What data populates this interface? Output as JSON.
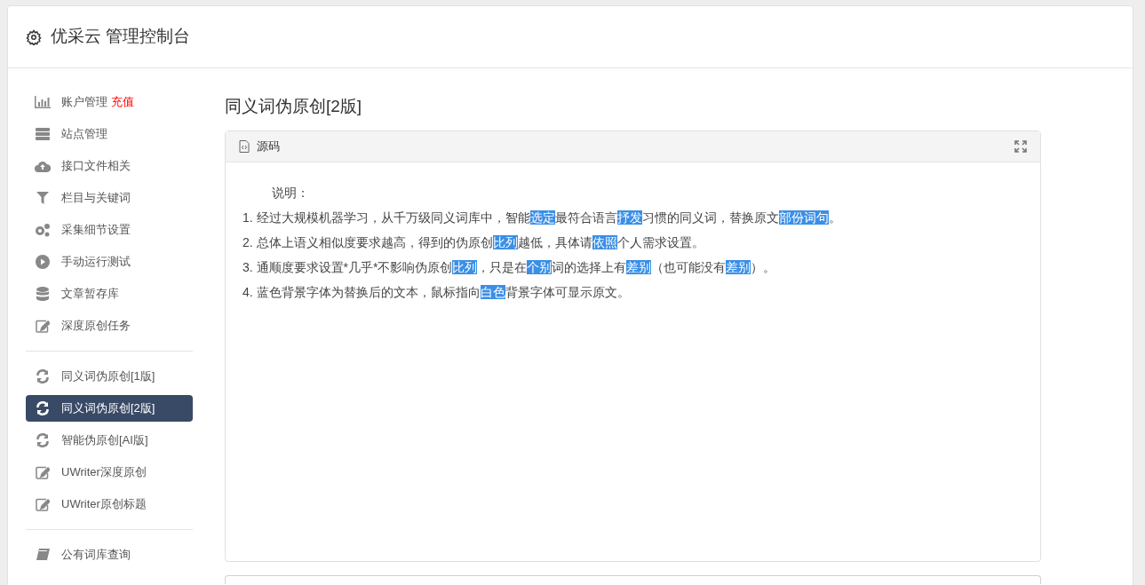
{
  "header": {
    "title": "优采云 管理控制台"
  },
  "sidebar": {
    "groups": [
      {
        "items": [
          {
            "label": "账户管理",
            "badge": "充值",
            "selected": false
          },
          {
            "label": "站点管理",
            "selected": false
          },
          {
            "label": "接口文件相关",
            "selected": false
          },
          {
            "label": "栏目与关键词",
            "selected": false
          },
          {
            "label": "采集细节设置",
            "selected": false
          },
          {
            "label": "手动运行测试",
            "selected": false
          },
          {
            "label": "文章暂存库",
            "selected": false
          },
          {
            "label": "深度原创任务",
            "selected": false
          }
        ]
      },
      {
        "items": [
          {
            "label": "同义词伪原创[1版]",
            "selected": false
          },
          {
            "label": "同义词伪原创[2版]",
            "selected": true
          },
          {
            "label": "智能伪原创[AI版]",
            "selected": false
          },
          {
            "label": "UWriter深度原创",
            "selected": false
          },
          {
            "label": "UWriter原创标题",
            "selected": false
          }
        ]
      },
      {
        "items": [
          {
            "label": "公有词库查询",
            "selected": false
          }
        ]
      }
    ]
  },
  "main": {
    "title": "同义词伪原创[2版]",
    "panel": {
      "title": "源码",
      "heading": "说明：",
      "lines": [
        [
          {
            "text": "1. 经过大规模机器学习，从千万级同义词库中，智能",
            "highlight": false
          },
          {
            "text": "选定",
            "highlight": true
          },
          {
            "text": "最符合语言",
            "highlight": false
          },
          {
            "text": "抒发",
            "highlight": true
          },
          {
            "text": "习惯的同义词，替换原文",
            "highlight": false
          },
          {
            "text": "部份",
            "highlight": true
          },
          {
            "text": "词句",
            "highlight": true
          },
          {
            "text": "。",
            "highlight": false
          }
        ],
        [
          {
            "text": "2. 总体上语义相似度要求越高，得到的伪原创",
            "highlight": false
          },
          {
            "text": "比列",
            "highlight": true
          },
          {
            "text": "越低，具体请",
            "highlight": false
          },
          {
            "text": "依照",
            "highlight": true
          },
          {
            "text": "个人需求设置。",
            "highlight": false
          }
        ],
        [
          {
            "text": "3. 通顺度要求设置*几乎*不影响伪原创",
            "highlight": false
          },
          {
            "text": "比列",
            "highlight": true
          },
          {
            "text": "，只是在",
            "highlight": false
          },
          {
            "text": "个别",
            "highlight": true
          },
          {
            "text": "词的选择上有",
            "highlight": false
          },
          {
            "text": "差别",
            "highlight": true
          },
          {
            "text": "（也可能没有",
            "highlight": false
          },
          {
            "text": "差别",
            "highlight": true
          },
          {
            "text": "）。",
            "highlight": false
          }
        ],
        [
          {
            "text": "4. 蓝色背景字体为替换后的文本，鼠标指向",
            "highlight": false
          },
          {
            "text": "白色",
            "highlight": true
          },
          {
            "text": "背景字体可显示原文。",
            "highlight": false
          }
        ]
      ]
    }
  }
}
